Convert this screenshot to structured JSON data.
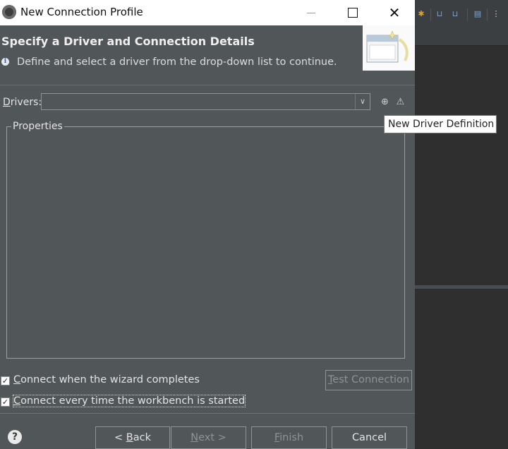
{
  "window": {
    "title": "New Connection Profile",
    "controls": [
      "minimize",
      "maximize",
      "close"
    ]
  },
  "header": {
    "title": "Specify a Driver and Connection Details",
    "description": "Define and select a driver from the drop-down list to continue."
  },
  "drivers": {
    "label_prefix": "D",
    "label_rest": "rivers:",
    "selected_value": "",
    "new_driver_icon": "new-driver-icon",
    "edit_driver_icon": "edit-driver-icon"
  },
  "tooltip": {
    "text": "New Driver Definition"
  },
  "properties": {
    "legend": "Properties"
  },
  "options": {
    "connect_when_complete": {
      "mnemonic": "C",
      "rest": "onnect when the wizard completes",
      "checked": true
    },
    "connect_every_time": {
      "mnemonic": "C",
      "rest": "onnect every time the workbench is started",
      "checked": true
    }
  },
  "buttons": {
    "test_connection": {
      "mnemonic": "T",
      "rest": "est Connection",
      "enabled": false
    },
    "back": {
      "prefix": "< ",
      "mnemonic": "B",
      "rest": "ack",
      "enabled": true
    },
    "next": {
      "mnemonic": "N",
      "rest": "ext >",
      "enabled": false
    },
    "finish": {
      "mnemonic": "F",
      "rest": "inish",
      "enabled": false
    },
    "cancel": {
      "label": "Cancel",
      "enabled": true
    }
  },
  "help_icon": "help-icon"
}
